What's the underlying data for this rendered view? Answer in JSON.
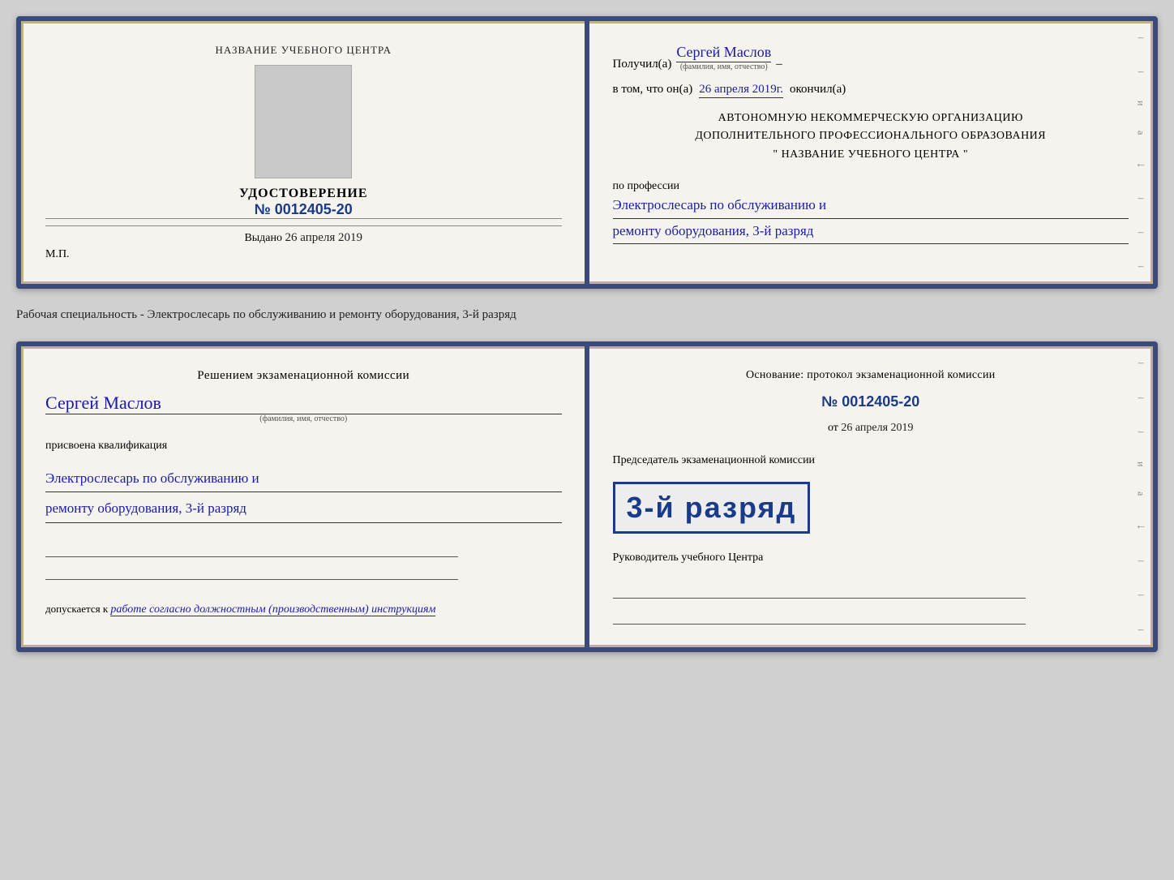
{
  "page": {
    "bg_color": "#d0d0d0"
  },
  "cert1": {
    "left": {
      "school_name": "НАЗВАНИЕ УЧЕБНОГО ЦЕНТРА",
      "udostoverenie": "УДОСТОВЕРЕНИЕ",
      "number": "№ 0012405-20",
      "vydano_label": "Выдано",
      "vydano_date": "26 апреля 2019",
      "mp": "М.П."
    },
    "right": {
      "poluchil": "Получил(а)",
      "name": "Сергей Маслов",
      "fio_label": "(фамилия, имя, отчество)",
      "dash": "–",
      "vtom_label": "в том, что он(а)",
      "date": "26 апреля 2019г.",
      "okonchil": "окончил(а)",
      "org_line1": "АВТОНОМНУЮ НЕКОММЕРЧЕСКУЮ ОРГАНИЗАЦИЮ",
      "org_line2": "ДОПОЛНИТЕЛЬНОГО ПРОФЕССИОНАЛЬНОГО ОБРАЗОВАНИЯ",
      "org_quote": "\"   НАЗВАНИЕ УЧЕБНОГО ЦЕНТРА   \"",
      "po_professii": "по профессии",
      "profession1": "Электрослесарь по обслуживанию и",
      "profession2": "ремонту оборудования, 3-й разряд"
    }
  },
  "spec_desc": "Рабочая специальность - Электрослесарь по обслуживанию и ремонту оборудования, 3-й разряд",
  "cert2": {
    "left": {
      "resheniem": "Решением экзаменационной  комиссии",
      "name": "Сергей Маслов",
      "fio_label": "(фамилия, имя, отчество)",
      "prisvoena": "присвоена квалификация",
      "qual1": "Электрослесарь по обслуживанию и",
      "qual2": "ремонту оборудования, 3-й разряд",
      "dopuskaetsya": "допускается к",
      "dopusk_text": "работе согласно должностным (производственным) инструкциям"
    },
    "right": {
      "osnovanie": "Основание: протокол экзаменационной  комиссии",
      "number": "№  0012405-20",
      "ot_label": "от",
      "ot_date": "26 апреля 2019",
      "predsedatel": "Председатель экзаменационной комиссии",
      "stamp_small": "3-й разряд",
      "stamp_large": "3-й разряд",
      "rukovoditel": "Руководитель учебного Центра"
    }
  },
  "deco": {
    "right_letters": "и а ←",
    "dashes": [
      "–",
      "–",
      "–",
      "–",
      "–",
      "–",
      "–"
    ]
  }
}
